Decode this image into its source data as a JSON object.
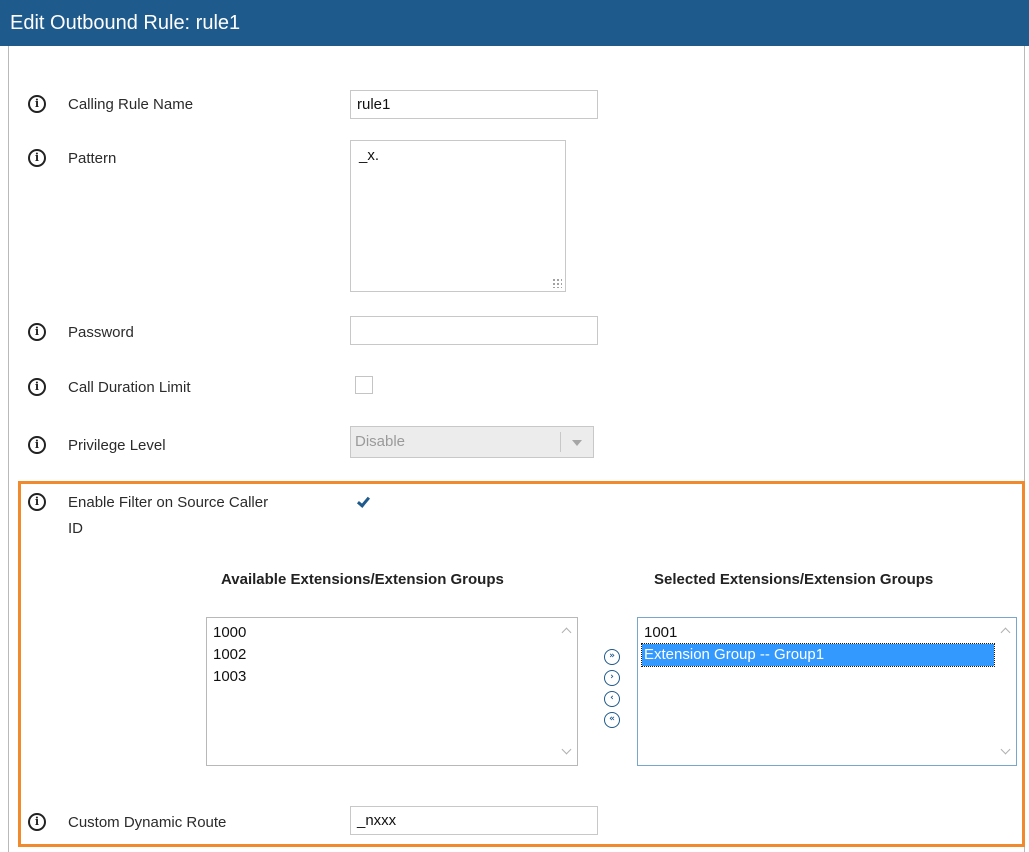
{
  "title": "Edit Outbound Rule: rule1",
  "fields": {
    "calling_rule_name": {
      "label": "Calling Rule Name",
      "value": "rule1"
    },
    "pattern": {
      "label": "Pattern",
      "value": "_x."
    },
    "password": {
      "label": "Password",
      "value": ""
    },
    "call_duration_limit": {
      "label": "Call Duration Limit",
      "checked": false
    },
    "privilege_level": {
      "label": "Privilege Level",
      "value": "Disable"
    },
    "enable_filter": {
      "label_line1": "Enable Filter on Source Caller",
      "label_line2": "ID",
      "checked": true
    },
    "custom_dynamic_route": {
      "label": "Custom Dynamic Route",
      "value": "_nxxx"
    }
  },
  "extensions": {
    "available_header": "Available Extensions/Extension Groups",
    "selected_header": "Selected Extensions/Extension Groups",
    "available": [
      "1000",
      "1002",
      "1003"
    ],
    "selected": [
      "1001",
      "Extension Group -- Group1"
    ],
    "selected_highlight_index": 1
  },
  "move_buttons": [
    "move-all-right",
    "move-right",
    "move-left",
    "move-all-left"
  ],
  "icons": {
    "info": "info-icon"
  },
  "colors": {
    "titlebar": "#1f5a8c",
    "highlight_border": "#f08a2c",
    "selection": "#3399ff"
  }
}
